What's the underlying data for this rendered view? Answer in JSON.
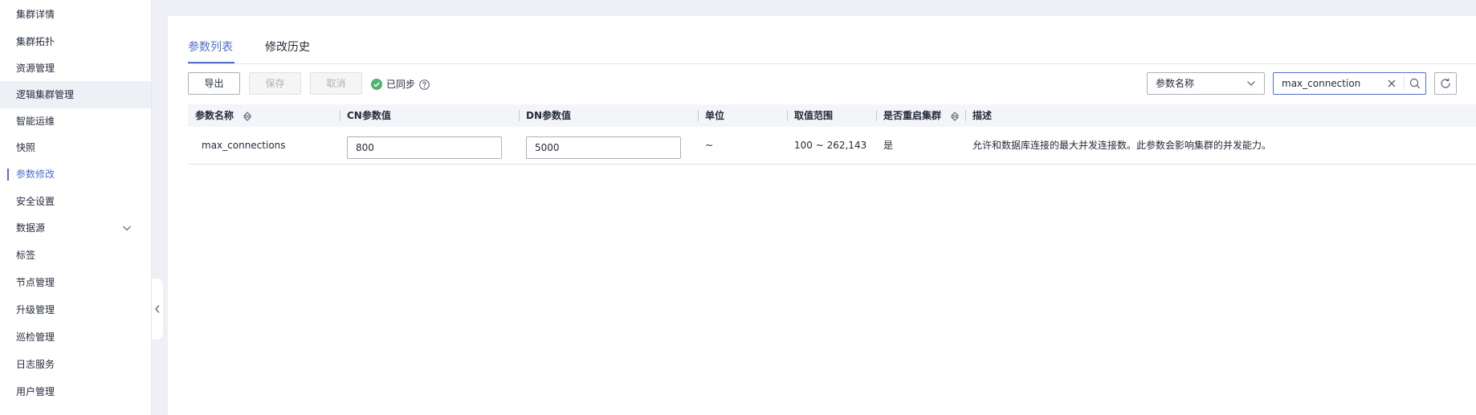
{
  "sidebar": {
    "items": [
      {
        "label": "集群详情"
      },
      {
        "label": "集群拓扑"
      },
      {
        "label": "资源管理"
      },
      {
        "label": "逻辑集群管理"
      },
      {
        "label": "智能运维"
      },
      {
        "label": "快照"
      },
      {
        "label": "参数修改"
      },
      {
        "label": "安全设置"
      },
      {
        "label": "数据源"
      },
      {
        "label": "标签"
      },
      {
        "label": "节点管理"
      },
      {
        "label": "升级管理"
      },
      {
        "label": "巡检管理"
      },
      {
        "label": "日志服务"
      },
      {
        "label": "用户管理"
      }
    ],
    "active_index": 6,
    "hover_index": 3
  },
  "tabs": [
    {
      "label": "参数列表",
      "active": true
    },
    {
      "label": "修改历史",
      "active": false
    }
  ],
  "toolbar": {
    "export_label": "导出",
    "save_label": "保存",
    "cancel_label": "取消",
    "sync_status": "已同步"
  },
  "filter": {
    "field_select": "参数名称",
    "search_value": "max_connection"
  },
  "table": {
    "columns": [
      "参数名称",
      "CN参数值",
      "DN参数值",
      "单位",
      "取值范围",
      "是否重启集群",
      "描述"
    ],
    "rows": [
      {
        "name": "max_connections",
        "cn_value": "800",
        "dn_value": "5000",
        "unit": "~",
        "range": "100 ~ 262,143",
        "restart": "是",
        "description": "允许和数据库连接的最大并发连接数。此参数会影响集群的并发能力。"
      }
    ]
  },
  "colors": {
    "accent": "#526ecc",
    "sync_ok": "#50b371",
    "background": "#eef0f5"
  }
}
